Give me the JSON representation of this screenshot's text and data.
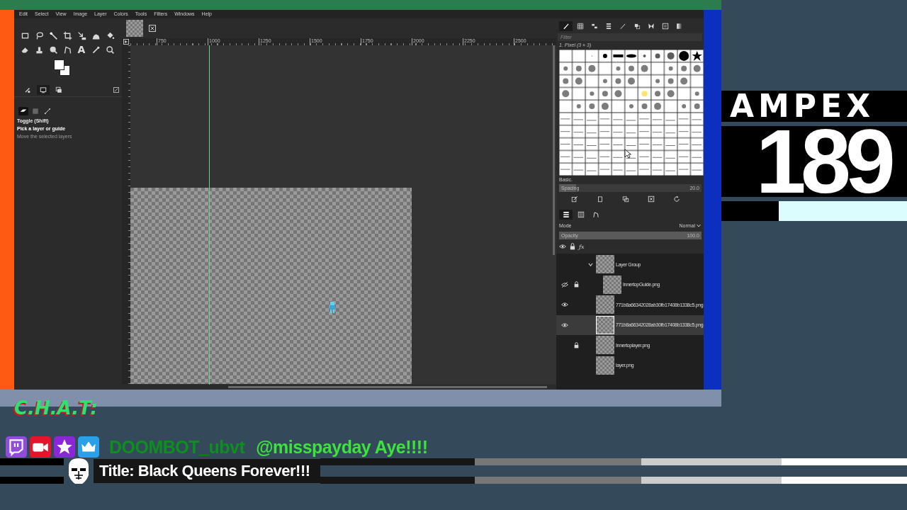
{
  "menu": [
    "Edit",
    "Select",
    "View",
    "Image",
    "Layer",
    "Colors",
    "Tools",
    "Filters",
    "Windows",
    "Help"
  ],
  "toolbox": {
    "tools": [
      {
        "kind": "rect-select"
      },
      {
        "kind": "lasso"
      },
      {
        "kind": "fuzzy-select"
      },
      {
        "kind": "crop"
      },
      {
        "kind": "transform"
      },
      {
        "kind": "warp"
      },
      {
        "kind": "bucket-fill"
      },
      {
        "kind": "eraser"
      },
      {
        "kind": "clone"
      },
      {
        "kind": "smudge"
      },
      {
        "kind": "paths"
      },
      {
        "kind": "text",
        "glyph": "A"
      },
      {
        "kind": "color-picker"
      },
      {
        "kind": "zoom"
      }
    ],
    "tabs": [
      {
        "kind": "device-status",
        "selected": false
      },
      {
        "kind": "tool-options",
        "selected": true
      },
      {
        "kind": "images",
        "selected": false
      }
    ],
    "modes": [
      {
        "kind": "layer",
        "selected": true
      },
      {
        "kind": "selection",
        "selected": false
      },
      {
        "kind": "path",
        "selected": false
      }
    ],
    "toggle_label": "Toggle (Shift)",
    "options": [
      {
        "label": "Pick a layer or guide",
        "selected": true
      },
      {
        "label": "Move the selected layers",
        "selected": false
      }
    ]
  },
  "canvas": {
    "ruler_labels": [
      "750",
      "1000",
      "1250",
      "1500",
      "1750",
      "2000",
      "2250",
      "2500"
    ]
  },
  "brushes": {
    "tabs": [
      {
        "kind": "brushes",
        "selected": true
      },
      {
        "kind": "patterns",
        "selected": false
      },
      {
        "kind": "fonts",
        "selected": false
      },
      {
        "kind": "history",
        "selected": false
      },
      {
        "kind": "dynamics",
        "selected": false
      },
      {
        "kind": "presets",
        "selected": false
      },
      {
        "kind": "mypaint",
        "selected": false
      },
      {
        "kind": "palettes",
        "selected": false
      },
      {
        "kind": "gradients",
        "selected": false
      }
    ],
    "filter_placeholder": "Filter",
    "brush_name": "1. Pixel (3 × 3)",
    "tag": "Basic.",
    "spacing": {
      "label": "Spacing",
      "value": "20.0",
      "level": 0.12
    },
    "actions": [
      {
        "kind": "edit"
      },
      {
        "kind": "new"
      },
      {
        "kind": "duplicate"
      },
      {
        "kind": "delete"
      },
      {
        "kind": "refresh"
      }
    ]
  },
  "layers": {
    "tabs": [
      {
        "kind": "layers",
        "selected": true
      },
      {
        "kind": "channels",
        "selected": false
      },
      {
        "kind": "paths",
        "selected": false
      }
    ],
    "mode": {
      "label": "Mode",
      "value": "Normal"
    },
    "opacity": {
      "label": "Opacity",
      "value": "100.0",
      "level": 1
    },
    "columns": [
      {
        "kind": "eye"
      },
      {
        "kind": "lock"
      },
      {
        "kind": "effects",
        "glyph": "ƒx"
      }
    ],
    "items": [
      {
        "name": "Layer Group",
        "visible": false,
        "crossed": false,
        "locked": false,
        "selected": false,
        "expanded": true,
        "children": [
          {
            "name": "InnertopGuide.png",
            "visible": false,
            "crossed": true,
            "locked": true,
            "selected": false
          }
        ]
      },
      {
        "name": "771b8a66342028ab30fb17408b1338c5.png",
        "visible": true,
        "crossed": false,
        "locked": false,
        "selected": false
      },
      {
        "name": "771b8a66342028ab30fb17408b1338c5.png",
        "visible": true,
        "crossed": false,
        "locked": false,
        "selected": true
      },
      {
        "name": "Innertoplayer.png",
        "visible": false,
        "crossed": false,
        "locked": true,
        "selected": false
      },
      {
        "name": "layer.png",
        "visible": false,
        "crossed": false,
        "locked": false,
        "selected": false
      }
    ]
  },
  "counter": {
    "brand": "AMPEX",
    "number": "189"
  },
  "chat": {
    "logo": "C.H.A.T:",
    "badges": [
      {
        "kind": "twitch"
      },
      {
        "kind": "camera"
      },
      {
        "kind": "star"
      },
      {
        "kind": "crown"
      }
    ],
    "user": "DOOMBOT_ubvt",
    "message": "@misspayday Aye!!!!"
  },
  "ticker": {
    "title": "Title: Black Queens Forever!!!"
  }
}
